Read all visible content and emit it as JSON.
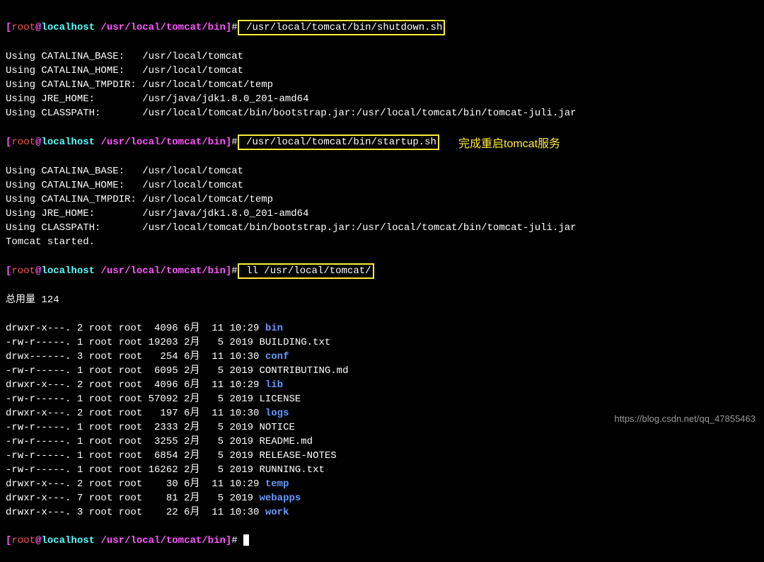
{
  "prompt": {
    "open": "[",
    "user": "root",
    "at": "@",
    "host": "localhost",
    "path": " /usr/local/tomcat/bin",
    "close": "]",
    "hash": "#"
  },
  "cmd1": " /usr/local/tomcat/bin/shutdown.sh",
  "cmd2": " /usr/local/tomcat/bin/startup.sh",
  "cmd3": " ll /usr/local/tomcat/",
  "env1": [
    "Using CATALINA_BASE:   /usr/local/tomcat",
    "Using CATALINA_HOME:   /usr/local/tomcat",
    "Using CATALINA_TMPDIR: /usr/local/tomcat/temp",
    "Using JRE_HOME:        /usr/java/jdk1.8.0_201-amd64",
    "Using CLASSPATH:       /usr/local/tomcat/bin/bootstrap.jar:/usr/local/tomcat/bin/tomcat-juli.jar"
  ],
  "env2": [
    "Using CATALINA_BASE:   /usr/local/tomcat",
    "Using CATALINA_HOME:   /usr/local/tomcat",
    "Using CATALINA_TMPDIR: /usr/local/tomcat/temp",
    "Using JRE_HOME:        /usr/java/jdk1.8.0_201-amd64",
    "Using CLASSPATH:       /usr/local/tomcat/bin/bootstrap.jar:/usr/local/tomcat/bin/tomcat-juli.jar",
    "Tomcat started."
  ],
  "total": "总用量 124",
  "listing": [
    {
      "perm": "drwxr-x---.",
      "links": "2",
      "own": "root",
      "grp": "root",
      "size": "  4096",
      "mon": "6月",
      "day": "11",
      "time": "10:29",
      "name": "bin",
      "dir": true
    },
    {
      "perm": "-rw-r-----.",
      "links": "1",
      "own": "root",
      "grp": "root",
      "size": " 19203",
      "mon": "2月",
      "day": " 5",
      "time": "2019",
      "name": "BUILDING.txt",
      "dir": false
    },
    {
      "perm": "drwx------.",
      "links": "3",
      "own": "root",
      "grp": "root",
      "size": "   254",
      "mon": "6月",
      "day": "11",
      "time": "10:30",
      "name": "conf",
      "dir": true
    },
    {
      "perm": "-rw-r-----.",
      "links": "1",
      "own": "root",
      "grp": "root",
      "size": "  6095",
      "mon": "2月",
      "day": " 5",
      "time": "2019",
      "name": "CONTRIBUTING.md",
      "dir": false
    },
    {
      "perm": "drwxr-x---.",
      "links": "2",
      "own": "root",
      "grp": "root",
      "size": "  4096",
      "mon": "6月",
      "day": "11",
      "time": "10:29",
      "name": "lib",
      "dir": true
    },
    {
      "perm": "-rw-r-----.",
      "links": "1",
      "own": "root",
      "grp": "root",
      "size": " 57092",
      "mon": "2月",
      "day": " 5",
      "time": "2019",
      "name": "LICENSE",
      "dir": false
    },
    {
      "perm": "drwxr-x---.",
      "links": "2",
      "own": "root",
      "grp": "root",
      "size": "   197",
      "mon": "6月",
      "day": "11",
      "time": "10:30",
      "name": "logs",
      "dir": true
    },
    {
      "perm": "-rw-r-----.",
      "links": "1",
      "own": "root",
      "grp": "root",
      "size": "  2333",
      "mon": "2月",
      "day": " 5",
      "time": "2019",
      "name": "NOTICE",
      "dir": false
    },
    {
      "perm": "-rw-r-----.",
      "links": "1",
      "own": "root",
      "grp": "root",
      "size": "  3255",
      "mon": "2月",
      "day": " 5",
      "time": "2019",
      "name": "README.md",
      "dir": false
    },
    {
      "perm": "-rw-r-----.",
      "links": "1",
      "own": "root",
      "grp": "root",
      "size": "  6854",
      "mon": "2月",
      "day": " 5",
      "time": "2019",
      "name": "RELEASE-NOTES",
      "dir": false
    },
    {
      "perm": "-rw-r-----.",
      "links": "1",
      "own": "root",
      "grp": "root",
      "size": " 16262",
      "mon": "2月",
      "day": " 5",
      "time": "2019",
      "name": "RUNNING.txt",
      "dir": false
    },
    {
      "perm": "drwxr-x---.",
      "links": "2",
      "own": "root",
      "grp": "root",
      "size": "    30",
      "mon": "6月",
      "day": "11",
      "time": "10:29",
      "name": "temp",
      "dir": true
    },
    {
      "perm": "drwxr-x---.",
      "links": "7",
      "own": "root",
      "grp": "root",
      "size": "    81",
      "mon": "2月",
      "day": " 5",
      "time": "2019",
      "name": "webapps",
      "dir": true
    },
    {
      "perm": "drwxr-x---.",
      "links": "3",
      "own": "root",
      "grp": "root",
      "size": "    22",
      "mon": "6月",
      "day": "11",
      "time": "10:30",
      "name": "work",
      "dir": true
    }
  ],
  "annotation": "完成重启tomcat服务",
  "watermark": "https://blog.csdn.net/qq_47855463"
}
